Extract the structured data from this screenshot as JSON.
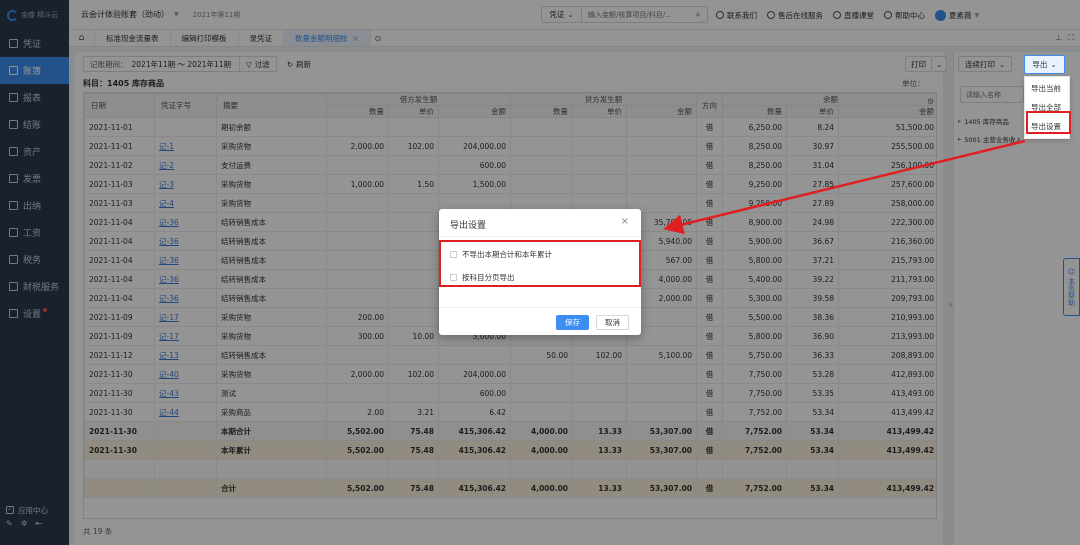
{
  "app": {
    "logo": "金蝶 精斗云",
    "account": "云会计体验账套（劲动）",
    "period": "2021年第11期"
  },
  "sidebar": {
    "items": [
      {
        "label": "凭证",
        "icon": "voucher-icon"
      },
      {
        "label": "账簿",
        "icon": "ledger-icon",
        "active": true
      },
      {
        "label": "报表",
        "icon": "report-icon"
      },
      {
        "label": "结账",
        "icon": "closing-icon"
      },
      {
        "label": "资产",
        "icon": "asset-icon"
      },
      {
        "label": "发票",
        "icon": "invoice-icon"
      },
      {
        "label": "出纳",
        "icon": "cashier-icon"
      },
      {
        "label": "工资",
        "icon": "salary-icon"
      },
      {
        "label": "税务",
        "icon": "tax-icon"
      },
      {
        "label": "财税服务",
        "icon": "service-icon"
      },
      {
        "label": "设置",
        "icon": "settings-icon",
        "dot": true
      }
    ],
    "app_center": "应用中心"
  },
  "topbar": {
    "search_type": "凭证",
    "search_placeholder": "输入金额/核算项目/科目/...",
    "contact": "联系我们",
    "online_service": "售后在线服务",
    "live_class": "直播课堂",
    "help_center": "帮助中心",
    "user": "夏素薇"
  },
  "tabs": [
    {
      "label": "标准现金流量表"
    },
    {
      "label": "编辑打印模板"
    },
    {
      "label": "录凭证"
    },
    {
      "label": "数量金额明细账",
      "active": true,
      "closable": true
    }
  ],
  "toolbar": {
    "period_label": "记账期间：",
    "period_value": "2021年11期 ～ 2021年11期",
    "filter": "过滤",
    "refresh": "刷新",
    "print": "打印",
    "continuous_print": "连续打印",
    "export": "导出"
  },
  "subject": "科目：1405 库存商品",
  "unit_label": "单位：",
  "table": {
    "headers": {
      "date": "日期",
      "voucher_no": "凭证字号",
      "summary": "摘要",
      "debit": "借方发生额",
      "credit": "贷方发生额",
      "direction": "方向",
      "balance": "余额",
      "qty": "数量",
      "price": "单价",
      "amount": "金额"
    },
    "rows": [
      {
        "date": "2021-11-01",
        "vno": "",
        "summary": "期初余额",
        "dq": "",
        "dp": "",
        "da": "",
        "cq": "",
        "cp": "",
        "ca": "",
        "dir": "借",
        "bq": "6,250.00",
        "bp": "8.24",
        "ba": "51,500.00"
      },
      {
        "date": "2021-11-01",
        "vno": "记-1",
        "summary": "采购货物",
        "dq": "2,000.00",
        "dp": "102.00",
        "da": "204,000.00",
        "cq": "",
        "cp": "",
        "ca": "",
        "dir": "借",
        "bq": "8,250.00",
        "bp": "30.97",
        "ba": "255,500.00"
      },
      {
        "date": "2021-11-02",
        "vno": "记-2",
        "summary": "支付运费",
        "dq": "",
        "dp": "",
        "da": "600.00",
        "cq": "",
        "cp": "",
        "ca": "",
        "dir": "借",
        "bq": "8,250.00",
        "bp": "31.04",
        "ba": "256,100.00"
      },
      {
        "date": "2021-11-03",
        "vno": "记-3",
        "summary": "采购货物",
        "dq": "1,000.00",
        "dp": "1.50",
        "da": "1,500.00",
        "cq": "",
        "cp": "",
        "ca": "",
        "dir": "借",
        "bq": "9,250.00",
        "bp": "27.85",
        "ba": "257,600.00"
      },
      {
        "date": "2021-11-03",
        "vno": "记-4",
        "summary": "采购货物",
        "dq": "",
        "dp": "",
        "da": "",
        "cq": "",
        "cp": "",
        "ca": "",
        "dir": "借",
        "bq": "9,250.00",
        "bp": "27.89",
        "ba": "258,000.00"
      },
      {
        "date": "2021-11-04",
        "vno": "记-36",
        "summary": "结转销售成本",
        "dq": "",
        "dp": "",
        "da": "",
        "cq": "",
        "cp": "",
        "ca": "35,700.00",
        "dir": "借",
        "bq": "8,900.00",
        "bp": "24.98",
        "ba": "222,300.00"
      },
      {
        "date": "2021-11-04",
        "vno": "记-36",
        "summary": "结转销售成本",
        "dq": "",
        "dp": "",
        "da": "",
        "cq": "",
        "cp": "",
        "ca": "5,940.00",
        "dir": "借",
        "bq": "5,900.00",
        "bp": "36.67",
        "ba": "216,360.00"
      },
      {
        "date": "2021-11-04",
        "vno": "记-36",
        "summary": "结转销售成本",
        "dq": "",
        "dp": "",
        "da": "",
        "cq": "",
        "cp": "",
        "ca": "567.00",
        "dir": "借",
        "bq": "5,800.00",
        "bp": "37.21",
        "ba": "215,793.00"
      },
      {
        "date": "2021-11-04",
        "vno": "记-36",
        "summary": "结转销售成本",
        "dq": "",
        "dp": "",
        "da": "",
        "cq": "",
        "cp": "",
        "ca": "4,000.00",
        "dir": "借",
        "bq": "5,400.00",
        "bp": "39.22",
        "ba": "211,793.00"
      },
      {
        "date": "2021-11-04",
        "vno": "记-36",
        "summary": "结转销售成本",
        "dq": "",
        "dp": "",
        "da": "",
        "cq": "",
        "cp": "",
        "ca": "2,000.00",
        "dir": "借",
        "bq": "5,300.00",
        "bp": "39.58",
        "ba": "209,793.00"
      },
      {
        "date": "2021-11-09",
        "vno": "记-17",
        "summary": "采购货物",
        "dq": "200.00",
        "dp": "",
        "da": "",
        "cq": "",
        "cp": "",
        "ca": "",
        "dir": "借",
        "bq": "5,500.00",
        "bp": "38.36",
        "ba": "210,993.00"
      },
      {
        "date": "2021-11-09",
        "vno": "记-17",
        "summary": "采购货物",
        "dq": "300.00",
        "dp": "10.00",
        "da": "3,000.00",
        "cq": "",
        "cp": "",
        "ca": "",
        "dir": "借",
        "bq": "5,800.00",
        "bp": "36.90",
        "ba": "213,993.00"
      },
      {
        "date": "2021-11-12",
        "vno": "记-13",
        "summary": "结转销售成本",
        "dq": "",
        "dp": "",
        "da": "",
        "cq": "50.00",
        "cp": "102.00",
        "ca": "5,100.00",
        "dir": "借",
        "bq": "5,750.00",
        "bp": "36.33",
        "ba": "208,893.00"
      },
      {
        "date": "2021-11-30",
        "vno": "记-40",
        "summary": "采购货物",
        "dq": "2,000.00",
        "dp": "102.00",
        "da": "204,000.00",
        "cq": "",
        "cp": "",
        "ca": "",
        "dir": "借",
        "bq": "7,750.00",
        "bp": "53.28",
        "ba": "412,893.00"
      },
      {
        "date": "2021-11-30",
        "vno": "记-43",
        "summary": "测试",
        "dq": "",
        "dp": "",
        "da": "600.00",
        "cq": "",
        "cp": "",
        "ca": "",
        "dir": "借",
        "bq": "7,750.00",
        "bp": "53.35",
        "ba": "413,493.00"
      },
      {
        "date": "2021-11-30",
        "vno": "记-44",
        "summary": "采购商品",
        "dq": "2.00",
        "dp": "3.21",
        "da": "6.42",
        "cq": "",
        "cp": "",
        "ca": "",
        "dir": "借",
        "bq": "7,752.00",
        "bp": "53.34",
        "ba": "413,499.42"
      }
    ],
    "subtotal": {
      "date": "2021-11-30",
      "summary": "本期合计",
      "dq": "5,502.00",
      "dp": "75.48",
      "da": "415,306.42",
      "cq": "4,000.00",
      "cp": "13.33",
      "ca": "53,307.00",
      "dir": "借",
      "bq": "7,752.00",
      "bp": "53.34",
      "ba": "413,499.42"
    },
    "year_total": {
      "date": "2021-11-30",
      "summary": "本年累计",
      "dq": "5,502.00",
      "dp": "75.48",
      "da": "415,306.42",
      "cq": "4,000.00",
      "cp": "13.33",
      "ca": "53,307.00",
      "dir": "借",
      "bq": "7,752.00",
      "bp": "53.34",
      "ba": "413,499.42"
    },
    "grand_total": {
      "summary": "合计",
      "dq": "5,502.00",
      "dp": "75.48",
      "da": "415,306.42",
      "cq": "4,000.00",
      "cp": "13.33",
      "ca": "53,307.00",
      "dir": "借",
      "bq": "7,752.00",
      "bp": "53.34",
      "ba": "413,499.42"
    }
  },
  "footer": {
    "count": "共 19 条"
  },
  "right_panel": {
    "search_placeholder": "请输入名称",
    "tree": [
      "1405 库存商品",
      "5001 主营业务收入"
    ]
  },
  "export_menu": [
    "导出当前",
    "导出全部",
    "导出设置"
  ],
  "help_tab": "本页帮助",
  "dialog": {
    "title": "导出设置",
    "option1": "不导出本期合计和本年累计",
    "option2": "按科目分页导出",
    "save": "保存",
    "cancel": "取消"
  },
  "colors": {
    "accent": "#3d8ef0",
    "sidebar": "#2b3a4e",
    "annotation_red": "#e02020"
  }
}
